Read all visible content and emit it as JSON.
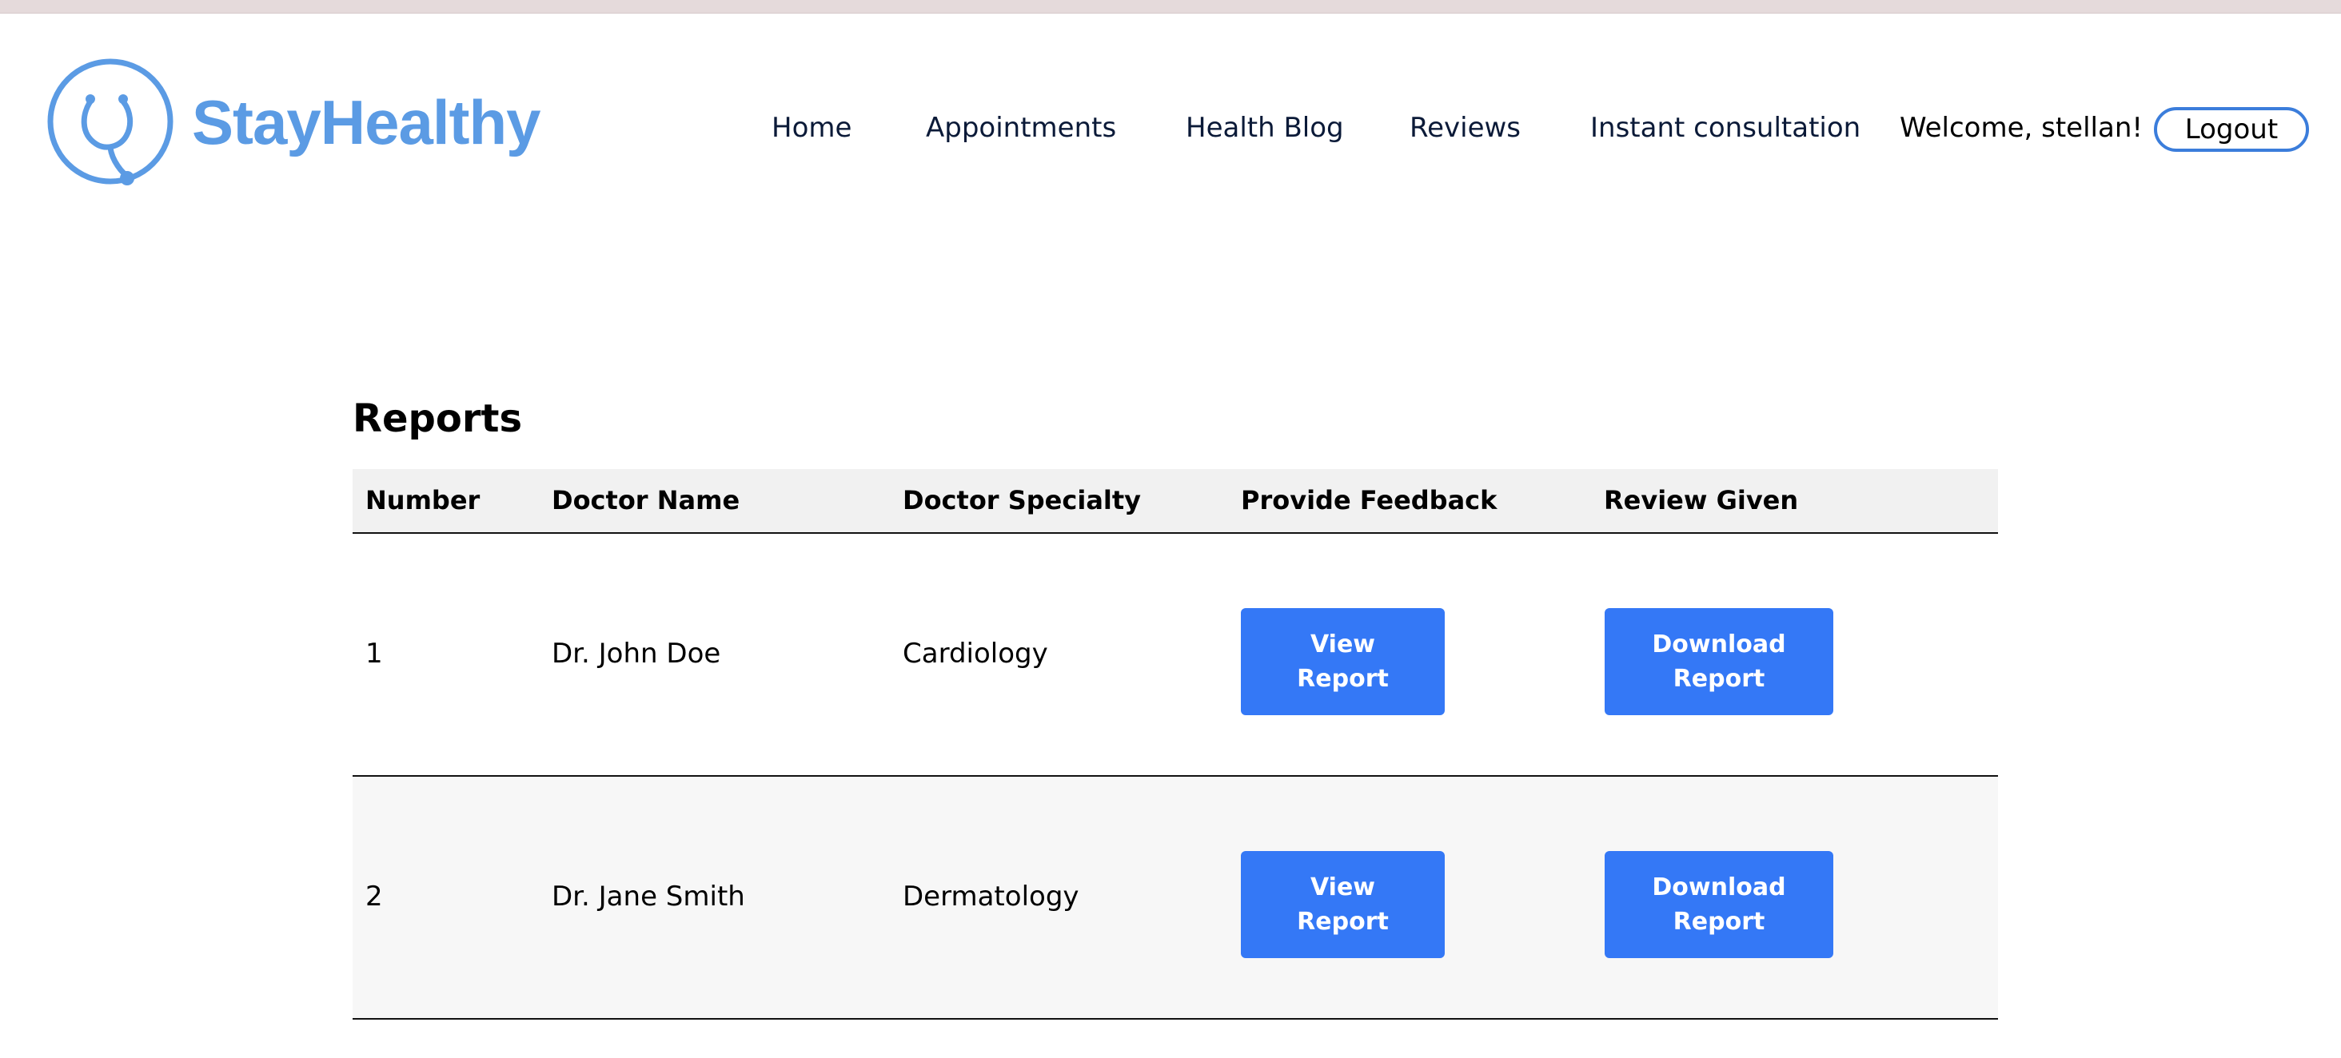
{
  "brand": {
    "name": "StayHealthy",
    "color": "#5b9be4",
    "icon": "stethoscope-icon"
  },
  "nav": {
    "items": [
      "Home",
      "Appointments",
      "Health Blog",
      "Reviews",
      "Instant consultation"
    ],
    "welcome": "Welcome, stellan!",
    "logout": "Logout"
  },
  "page": {
    "title": "Reports"
  },
  "table": {
    "headers": [
      "Number",
      "Doctor Name",
      "Doctor Specialty",
      "Provide Feedback",
      "Review Given"
    ],
    "rows": [
      {
        "number": "1",
        "doctor": "Dr. John Doe",
        "specialty": "Cardiology",
        "view_line1": "View",
        "view_line2": "Report",
        "download_line1": "Download",
        "download_line2": "Report"
      },
      {
        "number": "2",
        "doctor": "Dr. Jane Smith",
        "specialty": "Dermatology",
        "view_line1": "View",
        "view_line2": "Report",
        "download_line1": "Download",
        "download_line2": "Report"
      }
    ]
  },
  "colors": {
    "button": "#3478f6",
    "logout_border": "#3b7ddb",
    "header_bg": "#f1f1f1"
  }
}
